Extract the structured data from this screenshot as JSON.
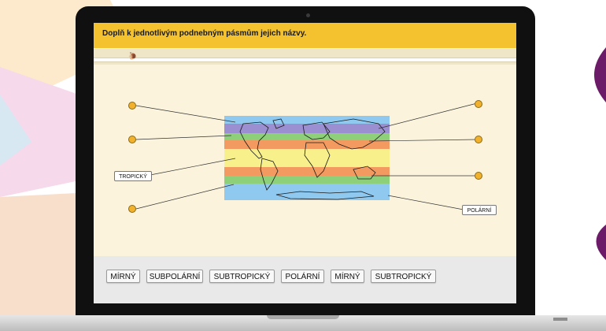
{
  "exercise": {
    "title": "Doplň k jednotlivým podnebným pásmům jejich názvy."
  },
  "map": {
    "placed_labels": [
      "TROPICKÝ",
      "POLÁRNÍ"
    ],
    "zone_colors": {
      "polar": "#8fc9ef",
      "subpolar": "#9c8fd1",
      "temperate": "#8ed07a",
      "subtropical": "#f39a60",
      "tropical": "#f7f08b"
    }
  },
  "answer_bank": {
    "chips": [
      "MÍRNÝ",
      "SUBPOLÁRNÍ",
      "SUBTROPICKÝ",
      "POLÁRNÍ",
      "MÍRNÝ",
      "SUBTROPICKÝ"
    ]
  },
  "colors": {
    "title_bar": "#f4c12f",
    "slot_dot": "#f2b12d",
    "background": "#fbf3dc"
  }
}
